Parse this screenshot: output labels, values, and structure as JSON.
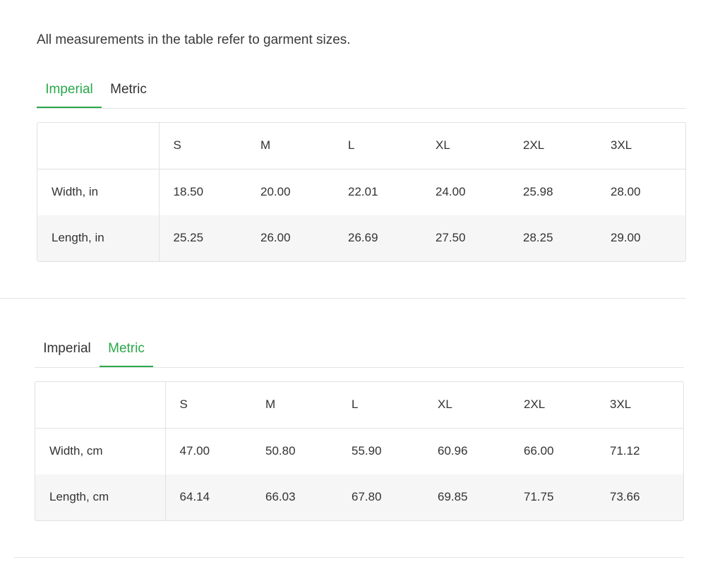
{
  "intro_text": "All measurements in the table refer to garment sizes.",
  "sections": [
    {
      "tabs": [
        {
          "label": "Imperial",
          "active": true
        },
        {
          "label": "Metric",
          "active": false
        }
      ],
      "table": {
        "sizes": [
          "S",
          "M",
          "L",
          "XL",
          "2XL",
          "3XL"
        ],
        "rows": [
          {
            "label": "Width, in",
            "values": [
              "18.50",
              "20.00",
              "22.01",
              "24.00",
              "25.98",
              "28.00"
            ]
          },
          {
            "label": "Length, in",
            "values": [
              "25.25",
              "26.00",
              "26.69",
              "27.50",
              "28.25",
              "29.00"
            ]
          }
        ]
      }
    },
    {
      "tabs": [
        {
          "label": "Imperial",
          "active": false
        },
        {
          "label": "Metric",
          "active": true
        }
      ],
      "table": {
        "sizes": [
          "S",
          "M",
          "L",
          "XL",
          "2XL",
          "3XL"
        ],
        "rows": [
          {
            "label": "Width, cm",
            "values": [
              "47.00",
              "50.80",
              "55.90",
              "60.96",
              "66.00",
              "71.12"
            ]
          },
          {
            "label": "Length, cm",
            "values": [
              "64.14",
              "66.03",
              "67.80",
              "69.85",
              "71.75",
              "73.66"
            ]
          }
        ]
      }
    }
  ],
  "colors": {
    "accent": "#2aa84a",
    "shaded_row": "#f6f6f6",
    "border": "#e1e1e1"
  }
}
